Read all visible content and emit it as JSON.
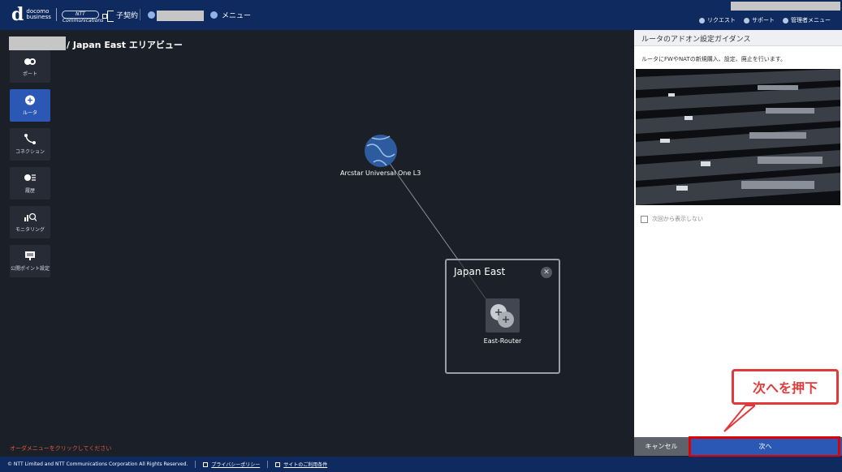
{
  "header": {
    "brand_top": "docomo",
    "brand_bottom": "business",
    "ntt_logo": "NTT Communications",
    "contract_label": "子契約",
    "menu_label": "メニュー",
    "request_label": "リクエスト",
    "support_label": "サポート",
    "admin_menu_label": "管理者メニュー"
  },
  "breadcrumb": "/ Japan East エリアビュー",
  "sidebar": {
    "items": [
      {
        "label": "ポート",
        "icon": "port-icon"
      },
      {
        "label": "ルータ",
        "icon": "router-icon"
      },
      {
        "label": "コネクション",
        "icon": "connection-icon"
      },
      {
        "label": "履歴",
        "icon": "history-icon"
      },
      {
        "label": "モニタリング",
        "icon": "monitoring-icon"
      },
      {
        "label": "公開ポイント設定",
        "icon": "public-point-icon"
      }
    ]
  },
  "map": {
    "node_label": "Arcstar Universal One L3",
    "region_title": "Japan East",
    "router_label": "East-Router",
    "order_hint": "オーダメニューをクリックしてください"
  },
  "panel": {
    "title": "ルータのアドオン設定ガイダンス",
    "description": "ルータにFWやNATの新規購入、設定、廃止を行います。",
    "checkbox_label": "次回から表示しない",
    "cancel_label": "キャンセル",
    "next_label": "次へ"
  },
  "callout": "次へを押下",
  "footer": {
    "copyright": "© NTT Limited and NTT Communications Corporation All Rights Reserved.",
    "privacy": "プライバシーポリシー",
    "terms": "サイトのご利用条件"
  }
}
